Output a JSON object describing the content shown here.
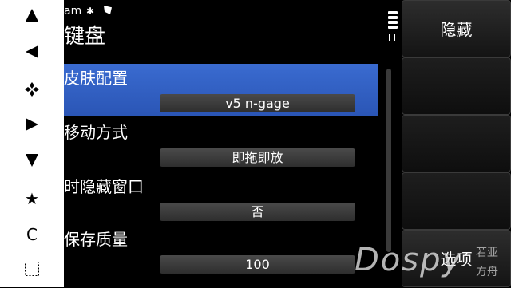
{
  "status": {
    "carrier": "am"
  },
  "title": "键盘",
  "settings": [
    {
      "label": "皮肤配置",
      "value": "v5 n-gage",
      "selected": true
    },
    {
      "label": "移动方式",
      "value": "即拖即放"
    },
    {
      "label": "时隐藏窗口",
      "value": "否"
    },
    {
      "label": "保存质量",
      "value": "100"
    }
  ],
  "softkeys": {
    "hide": "隐藏",
    "options": "选项"
  },
  "keypad": {
    "icons": [
      "up-arrow-icon",
      "left-arrow-icon",
      "select-icon",
      "right-arrow-icon",
      "down-arrow-icon",
      "star-icon",
      "clear-icon",
      "edit-box-icon"
    ],
    "star": "★",
    "clear": "C"
  },
  "watermark": {
    "brand": "Dospy",
    "cn_line1": "若亚",
    "cn_line2": "方舟"
  },
  "colors": {
    "selection": "#3a6bd0",
    "background": "#000000",
    "keypad_bg": "#ffffff"
  }
}
